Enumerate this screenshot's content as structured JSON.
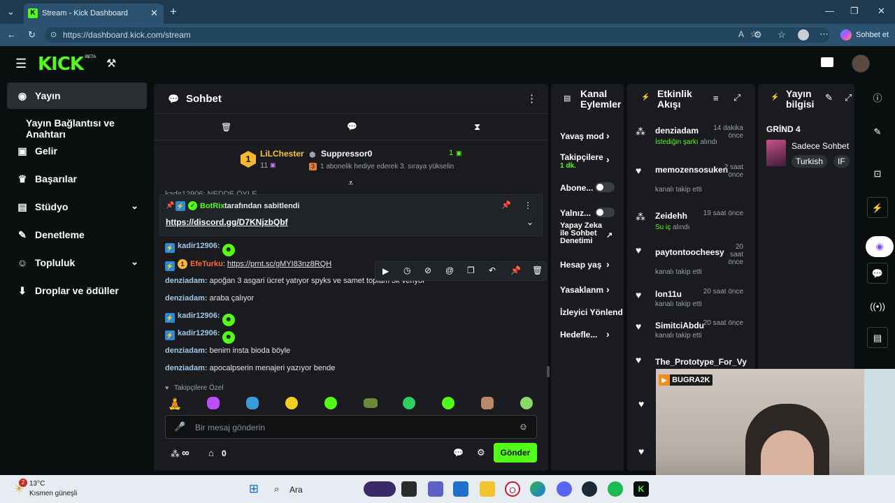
{
  "browser": {
    "tab_title": "Stream - Kick Dashboard",
    "url": "https://dashboard.kick.com/stream",
    "copilot_label": "Sohbet et"
  },
  "app": {
    "logo": "KICK",
    "logo_beta": "BETA"
  },
  "sidebar": {
    "items": [
      {
        "label": "Yayın",
        "icon": "broadcast-icon",
        "active": true
      },
      {
        "label": "Yayın Bağlantısı ve Anahtarı",
        "icon": "",
        "active": false
      },
      {
        "label": "Gelir",
        "icon": "wallet-icon",
        "active": false
      },
      {
        "label": "Başarılar",
        "icon": "trophy-icon",
        "active": false
      },
      {
        "label": "Stüdyo",
        "icon": "studio-icon",
        "active": false,
        "expandable": true
      },
      {
        "label": "Denetleme",
        "icon": "wrench-icon",
        "active": false
      },
      {
        "label": "Topluluk",
        "icon": "users-icon",
        "active": false,
        "expandable": true
      },
      {
        "label": "Droplar ve ödüller",
        "icon": "drops-icon",
        "active": false
      }
    ]
  },
  "chat": {
    "title": "Sohbet",
    "top_gifter": {
      "rank": "1",
      "name": "LiLChester",
      "count": "11"
    },
    "subscriber": {
      "name": "Suppressor0",
      "count": "1",
      "message": "1 abonelik hediye ederek 3. sıraya yükselin"
    },
    "partial_line": "kadir12906: NEDDE ÖYLE",
    "pinned": {
      "by": "BotRix",
      "by_suffix": "tarafından sabitlendi",
      "link": "https://discord.gg/D7KNjzbQbf"
    },
    "messages": [
      {
        "user": "kadir12906",
        "text": "",
        "emote": true,
        "badge": true
      },
      {
        "user": "EfeTurku",
        "text": "https://prnt.sc/gMYI83nz8RQH",
        "emote": false,
        "badge": true,
        "rank": "1"
      },
      {
        "user": "denziadam",
        "text": "apoğan 3 asgari ücret yatıyor spyks ve samet toplam 3k veriyor",
        "emote": false,
        "badge": false
      },
      {
        "user": "denziadam",
        "text": "araba çalıyor",
        "emote": false,
        "badge": false
      },
      {
        "user": "kadir12906",
        "text": "",
        "emote": true,
        "badge": true
      },
      {
        "user": "kadir12906",
        "text": "",
        "emote": true,
        "badge": true
      },
      {
        "user": "denziadam",
        "text": "benim insta bioda böyle",
        "emote": false,
        "badge": false
      },
      {
        "user": "denziadam",
        "text": "apocalpserin menajeri yazıyor bende",
        "emote": false,
        "badge": false
      }
    ],
    "followers_only_label": "Takipçilere Özel",
    "input_placeholder": "Bir mesaj gönderin",
    "points_symbol": "∞",
    "points_count": "0",
    "send_label": "Gönder"
  },
  "channel_actions": {
    "title_line1": "Kanal",
    "title_line2": "Eylemler",
    "items": [
      {
        "label": "Yavaş mod",
        "sub": "",
        "control": "arrow"
      },
      {
        "label": "Takipçilere",
        "sub": "1 dk.",
        "control": "arrow"
      },
      {
        "label": "Abone...",
        "sub": "",
        "control": "toggle"
      },
      {
        "label": "Yalnız...",
        "sub": "",
        "control": "toggle"
      },
      {
        "label": "Yapay Zeka ile Sohbet Denetimi",
        "sub": "",
        "control": "external"
      },
      {
        "label": "Hesap yaş",
        "sub": "",
        "control": "arrow"
      },
      {
        "label": "Yasaklanm",
        "sub": "",
        "control": "arrow"
      },
      {
        "label": "İzleyici Yönlendi",
        "sub": "",
        "control": "none"
      },
      {
        "label": "Hedefle...",
        "sub": "",
        "control": "arrow"
      }
    ]
  },
  "activity": {
    "title_line1": "Etkinlik",
    "title_line2": "Akışı",
    "items": [
      {
        "name": "denziadam",
        "time": "14 dakika önce",
        "sub_highlight": "İstediğin şarkı",
        "sub": "alındı",
        "icon": "points-icon"
      },
      {
        "name": "memozensosuken",
        "time": "2 saat önce",
        "sub_highlight": "",
        "sub": "kanalı takip etti",
        "icon": "heart-icon"
      },
      {
        "name": "Zeidehh",
        "time": "19 saat önce",
        "sub_highlight": "Su iç",
        "sub": "alındı",
        "icon": "points-icon"
      },
      {
        "name": "paytontoocheesy",
        "time": "20 saat önce",
        "sub_highlight": "",
        "sub": "kanalı takip etti",
        "icon": "heart-icon"
      },
      {
        "name": "lon11u",
        "time": "20 saat önce",
        "sub_highlight": "",
        "sub": "kanalı takip etti",
        "icon": "heart-icon"
      },
      {
        "name": "SimitciAbdu",
        "time": "20 saat önce",
        "sub_highlight": "",
        "sub": "kanalı takip etti",
        "icon": "heart-icon"
      },
      {
        "name": "The_Prototype_For_Vy",
        "time": "",
        "sub_highlight": "",
        "sub": "",
        "icon": "heart-icon"
      }
    ]
  },
  "stream_info": {
    "title_line1": "Yayın",
    "title_line2": "bilgisi",
    "stream_title": "GRİND 4",
    "category": "Sadece Sohbet",
    "tags": [
      "Turkish",
      "IF"
    ]
  },
  "webcam": {
    "overlay_label": "BUGRA2K"
  },
  "taskbar": {
    "weather_temp": "13°C",
    "weather_desc": "Kısmen güneşli",
    "weather_badge": "2",
    "search_label": "Ara"
  },
  "colors": {
    "kick_green": "#53fc18",
    "panel": "#191b1f",
    "background": "#0b0e0f"
  }
}
